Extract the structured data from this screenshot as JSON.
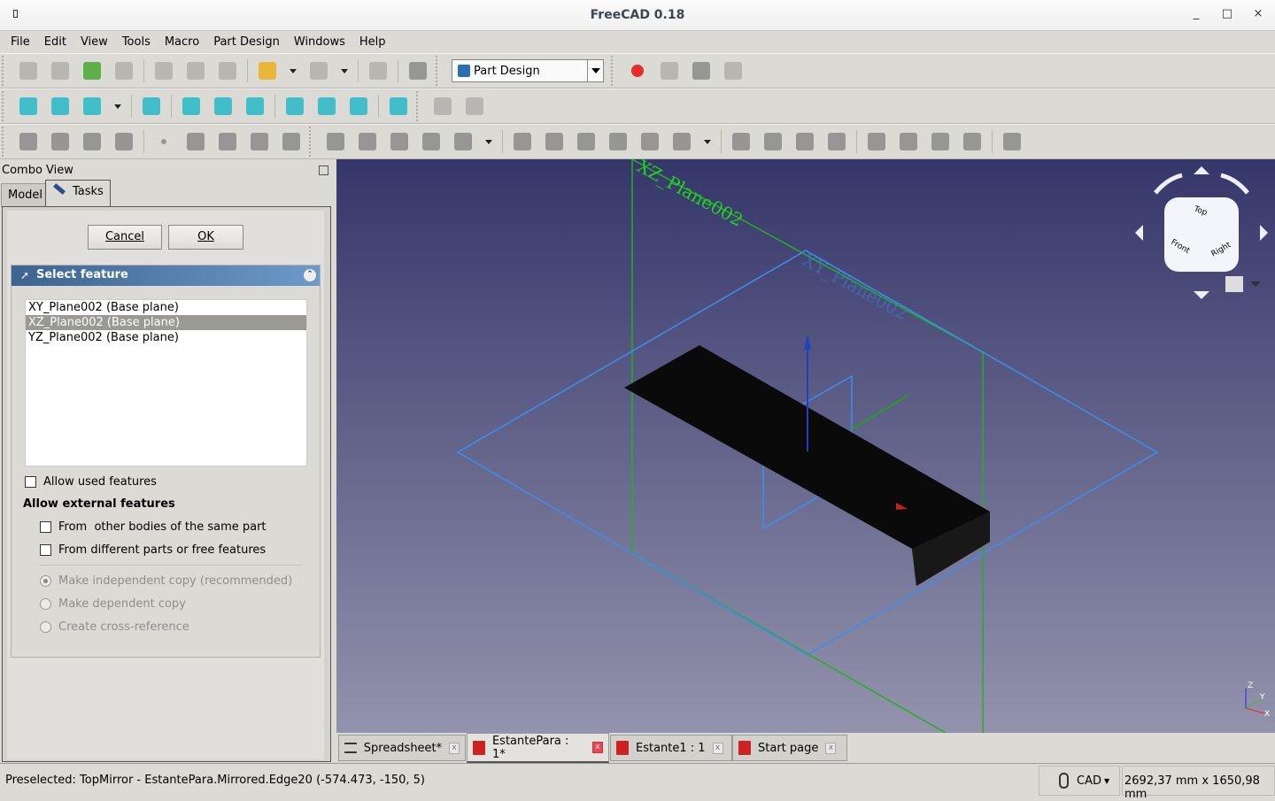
{
  "window": {
    "title": "FreeCAD 0.18",
    "minimize": "_",
    "maximize": "□",
    "close": "×"
  },
  "menu": [
    "File",
    "Edit",
    "View",
    "Tools",
    "Macro",
    "Part Design",
    "Windows",
    "Help"
  ],
  "toolbars": {
    "row1a": [
      "new-file-icon",
      "open-file-icon",
      "import-icon",
      "print-icon",
      "|",
      "cut-icon",
      "copy-icon",
      "paste-icon",
      "|",
      "undo-icon",
      "v",
      "redo-icon",
      "v",
      "|",
      "refresh-icon",
      "|",
      "whats-this-icon"
    ],
    "workbench": "Part Design",
    "row1b": [
      "macro-record-icon",
      "macro-stop-icon",
      "macro-edit-icon",
      "macro-run-icon"
    ],
    "row2a": [
      "fit-all-icon",
      "fit-selection-icon",
      "draw-style-icon",
      "v",
      "|",
      "isometric-view-icon",
      "|",
      "front-view-icon",
      "top-view-icon",
      "right-view-icon",
      "|",
      "rear-view-icon",
      "bottom-view-icon",
      "left-view-icon",
      "|",
      "measure-icon"
    ],
    "row2b": [
      "create-part-icon",
      "create-group-icon"
    ],
    "row3a": [
      "create-body-icon",
      "create-sketch-icon",
      "validate-sketch-icon",
      "shape-binder-icon",
      "|",
      "datum-point-icon",
      "datum-line-icon",
      "datum-plane-icon",
      "sub-shape-binder-icon",
      "clone-icon"
    ],
    "row3b": [
      "pad-icon",
      "revolution-icon",
      "additive-loft-icon",
      "additive-pipe-icon",
      "additive-primitive-icon",
      "v",
      "|",
      "pocket-icon",
      "hole-icon",
      "groove-icon",
      "subtractive-loft-icon",
      "subtractive-pipe-icon",
      "subtractive-primitive-icon",
      "v",
      "|",
      "mirrored-icon",
      "linear-pattern-icon",
      "polar-pattern-icon",
      "multi-transform-icon",
      "|",
      "fillet-icon",
      "chamfer-icon",
      "draft-icon",
      "thickness-icon",
      "|",
      "boolean-icon"
    ],
    "colors": {
      "tool": "#8a8a8a",
      "view": "#27b8c8",
      "record": "#e01010",
      "undo": "#e8b020",
      "import": "#4aa830"
    }
  },
  "combo": {
    "title": "Combo View",
    "tabs": [
      "Model",
      "Tasks"
    ],
    "cancel": "Cancel",
    "ok": "OK"
  },
  "select_feature": {
    "title": "Select feature",
    "items": [
      "XY_Plane002 (Base plane)",
      "XZ_Plane002 (Base plane)",
      "YZ_Plane002 (Base plane)"
    ],
    "selected_index": 1,
    "allow_used": {
      "label": "Allow used features",
      "checked": false
    },
    "external_heading": "Allow external features",
    "from_other_bodies": {
      "label": "From  other bodies of the same part",
      "checked": false
    },
    "from_different_parts": {
      "label": "From different parts or free features",
      "checked": false
    },
    "radios": [
      {
        "label": "Make independent copy (recommended)",
        "checked": true
      },
      {
        "label": "Make dependent copy",
        "checked": false
      },
      {
        "label": "Create cross-reference",
        "checked": false
      }
    ]
  },
  "viewport": {
    "plane_label": "XZ_Plane002",
    "plane_label_faint": "XY_Plane002",
    "navcube": {
      "top": "Top",
      "front": "Front",
      "right": "Right"
    },
    "axes": {
      "x": "X",
      "y": "Y",
      "z": "Z"
    }
  },
  "doc_tabs": [
    {
      "label": "Spreadsheet*",
      "active": false
    },
    {
      "label": "EstantePara : 1*",
      "active": true
    },
    {
      "label": "Estante1 : 1",
      "active": false
    },
    {
      "label": "Start page",
      "active": false
    }
  ],
  "status": {
    "message": "Preselected: TopMirror - EstantePara.Mirrored.Edge20 (-574.473, -150, 5)",
    "nav_style": "CAD",
    "dimensions": "2692,37 mm x 1650,98 mm"
  }
}
